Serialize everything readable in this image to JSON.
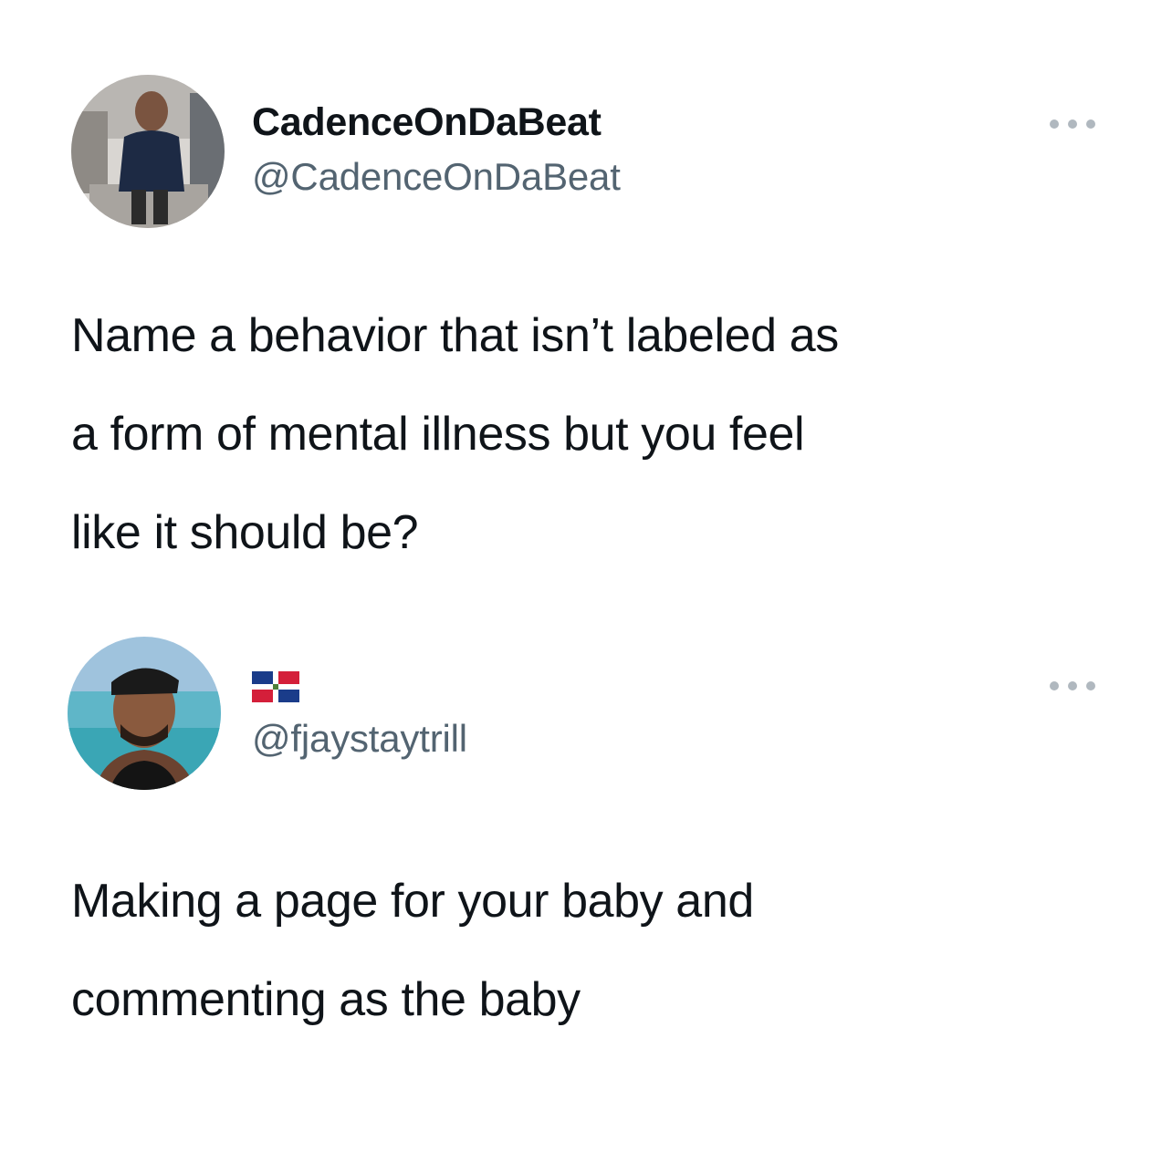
{
  "tweets": [
    {
      "display_name": "CadenceOnDaBeat",
      "handle": "@CadenceOnDaBeat",
      "avatar_icon": "profile-photo-man-in-navy-sweater",
      "text_lines": [
        "Name a behavior that isn’t labeled as",
        "a form of mental illness but you feel",
        "like it should be?"
      ]
    },
    {
      "name_icon": "dominican-republic-flag-icon",
      "handle": "@fjaystaytrill",
      "avatar_icon": "profile-photo-man-with-bandana-at-beach",
      "text_lines": [
        "Making a page for your baby and",
        "commenting as the baby"
      ]
    }
  ],
  "colors": {
    "text_primary": "#0f1419",
    "text_secondary": "#536471",
    "background": "#ffffff",
    "more_dots": "#b0b8bf"
  }
}
